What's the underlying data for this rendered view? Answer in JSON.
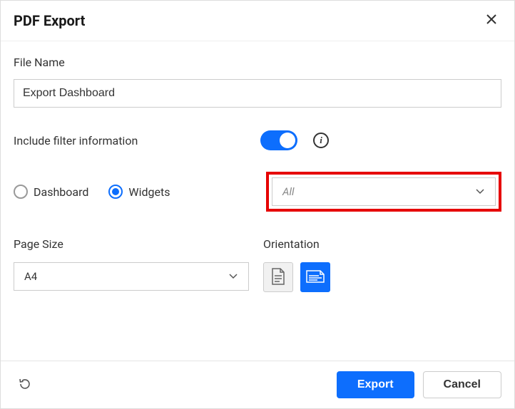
{
  "dialog": {
    "title": "PDF Export"
  },
  "fileName": {
    "label": "File Name",
    "value": "Export Dashboard"
  },
  "filterInfo": {
    "label": "Include filter information",
    "enabled": true
  },
  "scope": {
    "options": {
      "dashboard": "Dashboard",
      "widgets": "Widgets"
    },
    "selected": "widgets",
    "widgetSelectValue": "All"
  },
  "pageSize": {
    "label": "Page Size",
    "value": "A4"
  },
  "orientation": {
    "label": "Orientation",
    "selected": "landscape"
  },
  "footer": {
    "export": "Export",
    "cancel": "Cancel"
  }
}
